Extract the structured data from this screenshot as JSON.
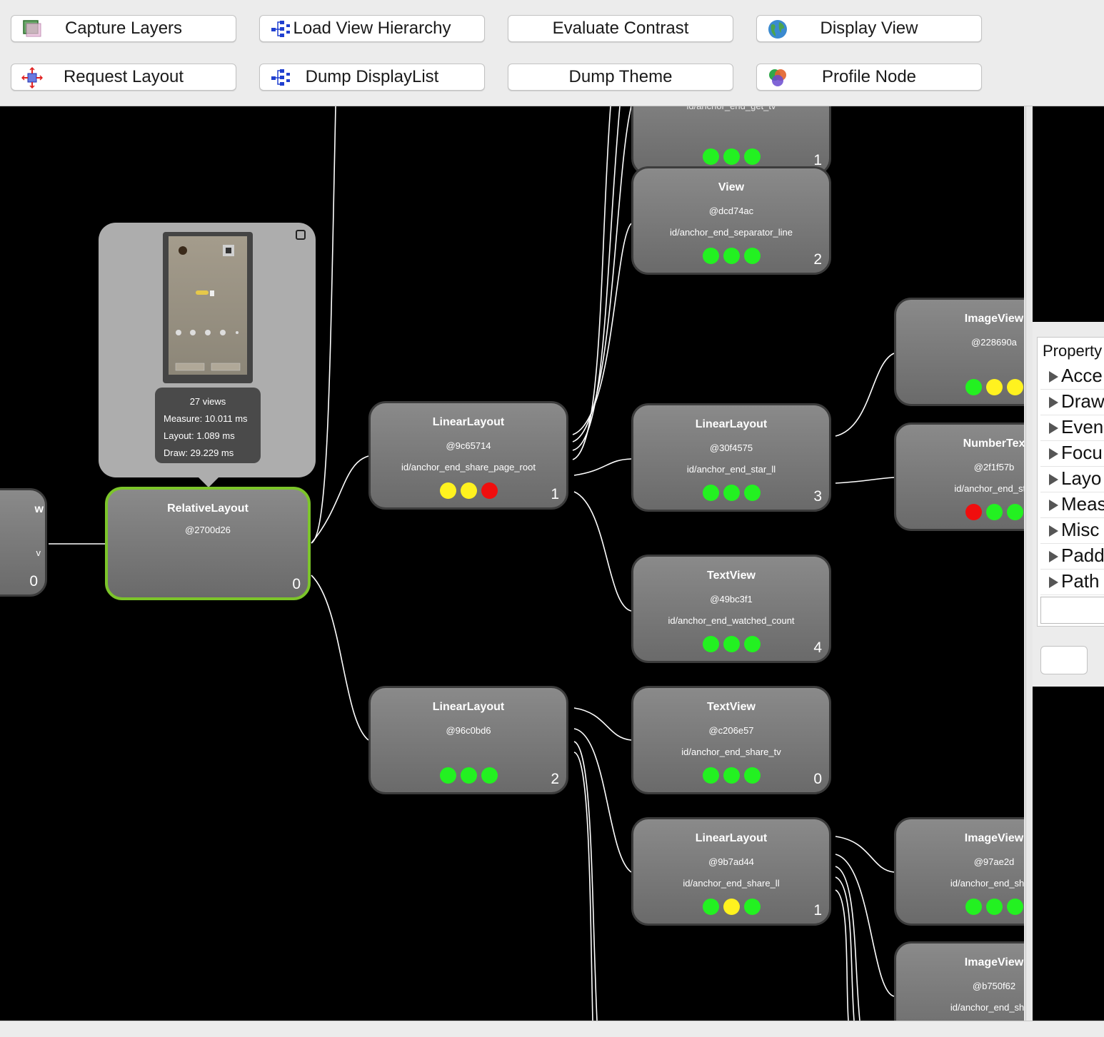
{
  "toolbar": {
    "buttons": [
      {
        "label": "Capture Layers",
        "icon": "layers-icon"
      },
      {
        "label": "Load View Hierarchy",
        "icon": "hierarchy-icon"
      },
      {
        "label": "Evaluate Contrast",
        "icon": ""
      },
      {
        "label": "Display View",
        "icon": "globe-icon"
      },
      {
        "label": "Request Layout",
        "icon": "request-layout-icon"
      },
      {
        "label": "Dump DisplayList",
        "icon": "hierarchy-icon"
      },
      {
        "label": "Dump Theme",
        "icon": ""
      },
      {
        "label": "Profile Node",
        "icon": "profile-node-icon"
      }
    ]
  },
  "tree": {
    "left_partial": {
      "title": "w",
      "id_fragment": "v",
      "count": "0"
    },
    "selected": {
      "title": "RelativeLayout",
      "hash": "@2700d26",
      "count": "0"
    },
    "nodes": [
      {
        "key": "top",
        "title": "",
        "hash": "",
        "id": "id/anchor_end_get_tv",
        "count": "1",
        "dots": [
          "green",
          "green",
          "green"
        ]
      },
      {
        "key": "view",
        "title": "View",
        "hash": "@dcd74ac",
        "id": "id/anchor_end_separator_line",
        "count": "2",
        "dots": [
          "green",
          "green",
          "green"
        ]
      },
      {
        "key": "ll1",
        "title": "LinearLayout",
        "hash": "@9c65714",
        "id": "id/anchor_end_share_page_root",
        "count": "1",
        "dots": [
          "yellow",
          "yellow",
          "red"
        ]
      },
      {
        "key": "ll_star",
        "title": "LinearLayout",
        "hash": "@30f4575",
        "id": "id/anchor_end_star_ll",
        "count": "3",
        "dots": [
          "green",
          "green",
          "green"
        ]
      },
      {
        "key": "tv_watched",
        "title": "TextView",
        "hash": "@49bc3f1",
        "id": "id/anchor_end_watched_count",
        "count": "4",
        "dots": [
          "green",
          "green",
          "green"
        ]
      },
      {
        "key": "ll2",
        "title": "LinearLayout",
        "hash": "@96c0bd6",
        "id": "",
        "count": "2",
        "dots": [
          "green",
          "green",
          "green"
        ]
      },
      {
        "key": "tv_share",
        "title": "TextView",
        "hash": "@c206e57",
        "id": "id/anchor_end_share_tv",
        "count": "0",
        "dots": [
          "green",
          "green",
          "green"
        ]
      },
      {
        "key": "ll_share",
        "title": "LinearLayout",
        "hash": "@9b7ad44",
        "id": "id/anchor_end_share_ll",
        "count": "1",
        "dots": [
          "green",
          "yellow",
          "green"
        ]
      },
      {
        "key": "iv1",
        "title": "ImageView",
        "hash": "@228690a",
        "id": "",
        "count": "",
        "dots": [
          "green",
          "yellow",
          "yellow"
        ]
      },
      {
        "key": "ntv",
        "title": "NumberTex",
        "hash": "@2f1f57b",
        "id": "id/anchor_end_star",
        "count": "",
        "dots": [
          "red",
          "green",
          "green"
        ]
      },
      {
        "key": "iv2",
        "title": "ImageView",
        "hash": "@97ae2d",
        "id": "id/anchor_end_share",
        "count": "",
        "dots": [
          "green",
          "green",
          "green"
        ]
      },
      {
        "key": "iv3",
        "title": "ImageView",
        "hash": "@b750f62",
        "id": "id/anchor_end_share",
        "count": "",
        "dots": []
      }
    ]
  },
  "tooltip": {
    "views": "27 views",
    "measure": "Measure: 10.011 ms",
    "layout": "Layout: 1.089 ms",
    "draw": "Draw: 29.229 ms"
  },
  "properties": {
    "header": "Property",
    "rows": [
      "Acce",
      "Draw",
      "Even",
      "Focu",
      "Layo",
      "Meas",
      "Misc",
      "Padd",
      "Path"
    ]
  },
  "colors": {
    "green": "#23f121",
    "yellow": "#fff21f",
    "red": "#f00e0e",
    "selection": "#7cc52a"
  }
}
